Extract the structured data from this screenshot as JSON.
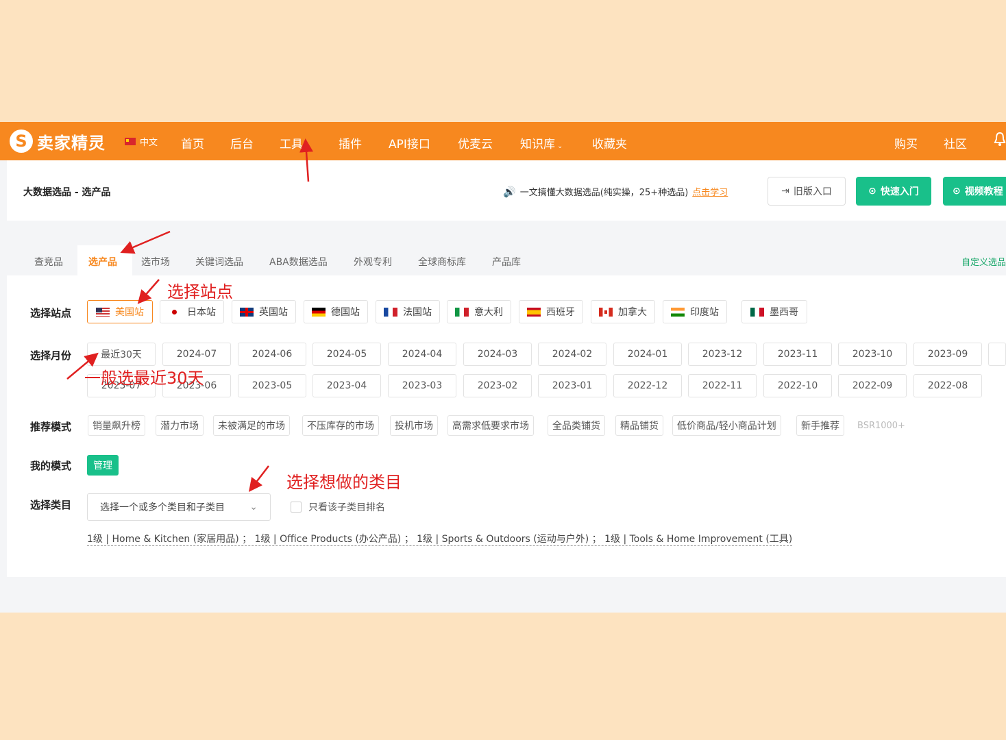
{
  "topbar": {
    "logo_text": "卖家精灵",
    "lang": "中文",
    "nav": [
      {
        "label": "首页"
      },
      {
        "label": "后台"
      },
      {
        "label": "工具",
        "caret": "⌄"
      },
      {
        "label": "插件"
      },
      {
        "label": "API接口"
      },
      {
        "label": "优麦云"
      },
      {
        "label": "知识库",
        "caret": "⌄"
      },
      {
        "label": "收藏夹"
      }
    ],
    "right": [
      {
        "label": "购买"
      },
      {
        "label": "社区"
      }
    ],
    "colors": {
      "bar": "#f7881f",
      "accent_green": "#19c08a"
    }
  },
  "header": {
    "title": "大数据选品 - 选产品",
    "notice_text": "一文搞懂大数据选品(纯实操，25+种选品)",
    "notice_link": "点击学习",
    "old_entry": "旧版入口",
    "quick_start": "快速入门",
    "video_tutorial": "视频教程"
  },
  "subtabs": {
    "items": [
      "查竞品",
      "选产品",
      "选市场",
      "关键词选品",
      "ABA数据选品",
      "外观专利",
      "全球商标库",
      "产品库"
    ],
    "active": "选产品",
    "custom": "自定义选品"
  },
  "filters": {
    "site_label": "选择站点",
    "sites": [
      {
        "label": "美国站",
        "flag": "us",
        "active": true
      },
      {
        "label": "日本站",
        "flag": "jp"
      },
      {
        "label": "英国站",
        "flag": "uk"
      },
      {
        "label": "德国站",
        "flag": "de"
      },
      {
        "label": "法国站",
        "flag": "fr"
      },
      {
        "label": "意大利",
        "flag": "it"
      },
      {
        "label": "西班牙",
        "flag": "es"
      },
      {
        "label": "加拿大",
        "flag": "ca"
      },
      {
        "label": "印度站",
        "flag": "in"
      },
      {
        "label": "墨西哥",
        "flag": "mx"
      }
    ],
    "month_label": "选择月份",
    "months_row1": [
      "最近30天",
      "2024-07",
      "2024-06",
      "2024-05",
      "2024-04",
      "2024-03",
      "2024-02",
      "2024-01",
      "2023-12",
      "2023-11",
      "2023-10",
      "2023-09"
    ],
    "months_row2": [
      "2023-07",
      "2023-06",
      "2023-05",
      "2023-04",
      "2023-03",
      "2023-02",
      "2023-01",
      "2022-12",
      "2022-11",
      "2022-10",
      "2022-09",
      "2022-08"
    ],
    "recommend_label": "推荐模式",
    "recommend": [
      "销量飙升榜",
      "潜力市场",
      "未被满足的市场",
      "不压库存的市场",
      "投机市场",
      "高需求低要求市场",
      "全品类铺货",
      "精品铺货",
      "低价商品/轻小商品计划",
      "新手推荐",
      "BSR1000+"
    ],
    "my_mode_label": "我的模式",
    "manage_button": "管理",
    "category_label": "选择类目",
    "category_placeholder": "选择一个或多个类目和子类目",
    "only_sub_label": "只看该子类目排名",
    "category_history": "1级 | Home & Kitchen (家居用品) ； 1级 | Office Products (办公产品) ； 1级 | Sports & Outdoors (运动与户外) ； 1级 | Tools & Home Improvement (工具)"
  },
  "annotations": {
    "site": "选择站点",
    "month": "一般选最近30天",
    "category": "选择想做的类目"
  }
}
